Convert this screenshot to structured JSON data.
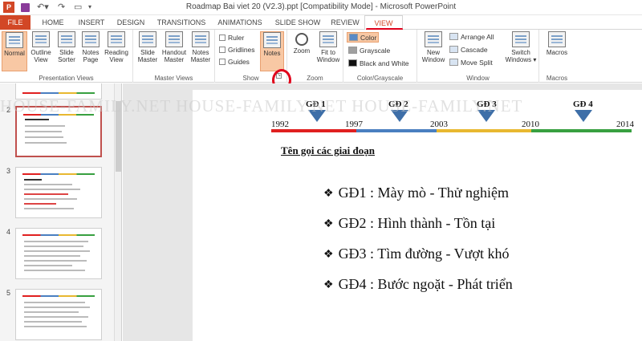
{
  "window": {
    "title": "Roadmap Bai viet 20 (V2.3).ppt [Compatibility Mode] - Microsoft PowerPoint"
  },
  "ribbon_tabs": [
    "FILE",
    "HOME",
    "INSERT",
    "DESIGN",
    "TRANSITIONS",
    "ANIMATIONS",
    "SLIDE SHOW",
    "REVIEW",
    "VIEW"
  ],
  "ribbon": {
    "presentation_views": {
      "label": "Presentation Views",
      "buttons": [
        "Normal",
        "Outline\nView",
        "Slide\nSorter",
        "Notes\nPage",
        "Reading\nView"
      ]
    },
    "master_views": {
      "label": "Master Views",
      "buttons": [
        "Slide\nMaster",
        "Handout\nMaster",
        "Notes\nMaster"
      ]
    },
    "show": {
      "label": "Show",
      "checkboxes": [
        "Ruler",
        "Gridlines",
        "Guides"
      ],
      "notes": "Notes"
    },
    "zoom": {
      "label": "Zoom",
      "buttons": [
        "Zoom",
        "Fit to\nWindow"
      ]
    },
    "color_grayscale": {
      "label": "Color/Grayscale",
      "options": [
        "Color",
        "Grayscale",
        "Black and White"
      ]
    },
    "window": {
      "label": "Window",
      "new_window": "New\nWindow",
      "options": [
        "Arrange All",
        "Cascade",
        "Move Split"
      ],
      "switch_windows": "Switch\nWindows ▾"
    },
    "macros": {
      "label": "Macros",
      "button": "Macros"
    }
  },
  "thumbnails": {
    "numbers": [
      "2",
      "3",
      "4",
      "5"
    ]
  },
  "slide": {
    "years": [
      "1992",
      "1997",
      "2003",
      "2010",
      "2014"
    ],
    "phases": [
      "GĐ 1",
      "GĐ 2",
      "GĐ 3",
      "GĐ 4"
    ],
    "section_title": "Tên gọi các giai đoạn",
    "bullets": [
      "GĐ1 : Mày mò - Thử nghiệm",
      "GĐ2 : Hình thành - Tồn tại",
      "GĐ3 : Tìm đường - Vượt khó",
      "GĐ4 : Bước ngoặt - Phát triển"
    ],
    "timeline_colors": [
      "#e02020",
      "#4a7fc0",
      "#e8b830",
      "#38a040"
    ]
  },
  "watermark": "HOUSE-FAMILY.NET     HOUSE-FAMILY.NET     HOUSE-FAMILY.NET",
  "colors": {
    "file_tab": "#d24726",
    "annotation_red": "#e0001a",
    "selection_orange": "#f8c8a4"
  }
}
